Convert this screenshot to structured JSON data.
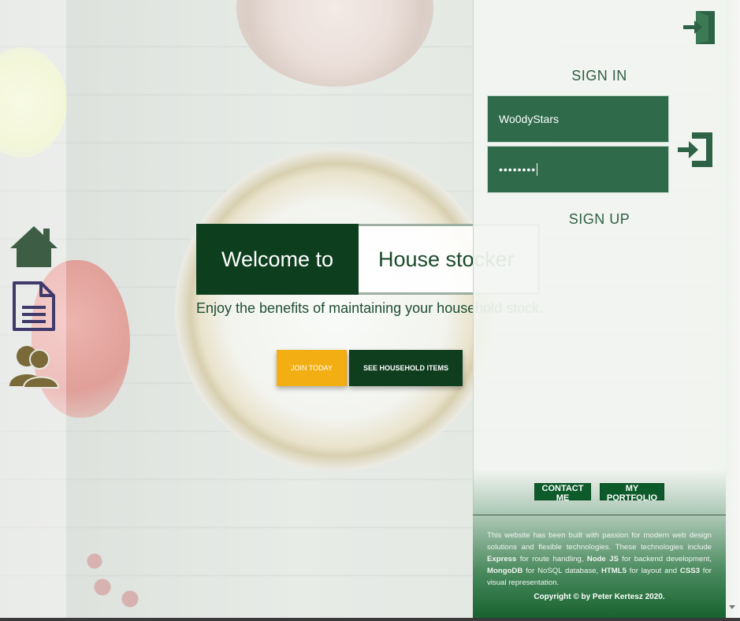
{
  "nav": {
    "items": [
      {
        "icon": "home-icon",
        "label": ""
      },
      {
        "icon": "document-icon",
        "label": ""
      },
      {
        "icon": "users-icon",
        "label": ""
      }
    ]
  },
  "hero": {
    "welcome": "Welcome to",
    "app_name": "House stocker",
    "subtitle": "Enjoy the benefits of maintaining your household stock.",
    "join_label": "JOIN TODAY",
    "items_label": "SEE HOUSEHOLD ITEMS"
  },
  "auth": {
    "signin_title": "SIGN IN",
    "username_value": "Wo0dyStars",
    "password_value": "••••••••",
    "signup_title": "SIGN UP"
  },
  "footer": {
    "contact_label": "CONTACT ME",
    "portfolio_label": "MY PORTFOLIO",
    "text_parts": {
      "p1": "This website has been built with passion for modern web design solutions and flexible technologies. These technologies include ",
      "express": "Express",
      "p2": " for route handling, ",
      "node": "Node JS",
      "p3": " for backend development, ",
      "mongo": "MongoDB",
      "p4": " for NoSQL database, ",
      "html": "HTML5",
      "p5": " for layout and ",
      "css": "CSS3",
      "p6": " for visual representation."
    },
    "copyright": "Copyright © by Peter Kertesz 2020."
  },
  "colors": {
    "brand_dark_green": "#0d3f1f",
    "field_green": "#2f6b4a",
    "accent_yellow": "#f2ae12",
    "nav_home": "#3d5e45",
    "nav_doc": "#3f3a6b",
    "nav_users": "#7a6a3a"
  }
}
